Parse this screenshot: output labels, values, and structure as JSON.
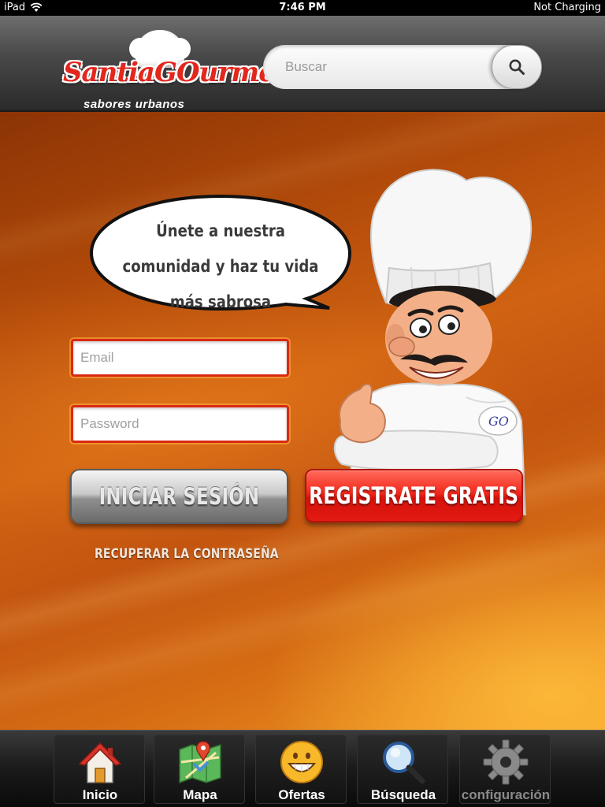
{
  "status_bar": {
    "device": "iPad",
    "time": "7:46 PM",
    "charging": "Not Charging"
  },
  "header": {
    "logo": {
      "brand": "SantiaGOurmet",
      "tagline": "sabores urbanos"
    },
    "search": {
      "placeholder": "Buscar",
      "icon": "search-icon"
    }
  },
  "main": {
    "speech_bubble": "Únete a nuestra comunidad y haz tu vida más sabrosa",
    "email_placeholder": "Email",
    "password_placeholder": "Password",
    "login_label": "INICIAR SESIÓN",
    "register_label": "REGISTRATE GRATIS",
    "recover_label": "RECUPERAR LA CONTRASEÑA",
    "colors": {
      "accent_red": "#e31a12",
      "field_border": "#d92a13",
      "background_orange": "#d06312"
    }
  },
  "tab_bar": {
    "tabs": [
      {
        "label": "Inicio",
        "icon": "home-icon"
      },
      {
        "label": "Mapa",
        "icon": "map-icon"
      },
      {
        "label": "Ofertas",
        "icon": "smiley-icon"
      },
      {
        "label": "Búsqueda",
        "icon": "magnifier-icon"
      },
      {
        "label": "configuración",
        "icon": "gear-icon"
      }
    ]
  }
}
